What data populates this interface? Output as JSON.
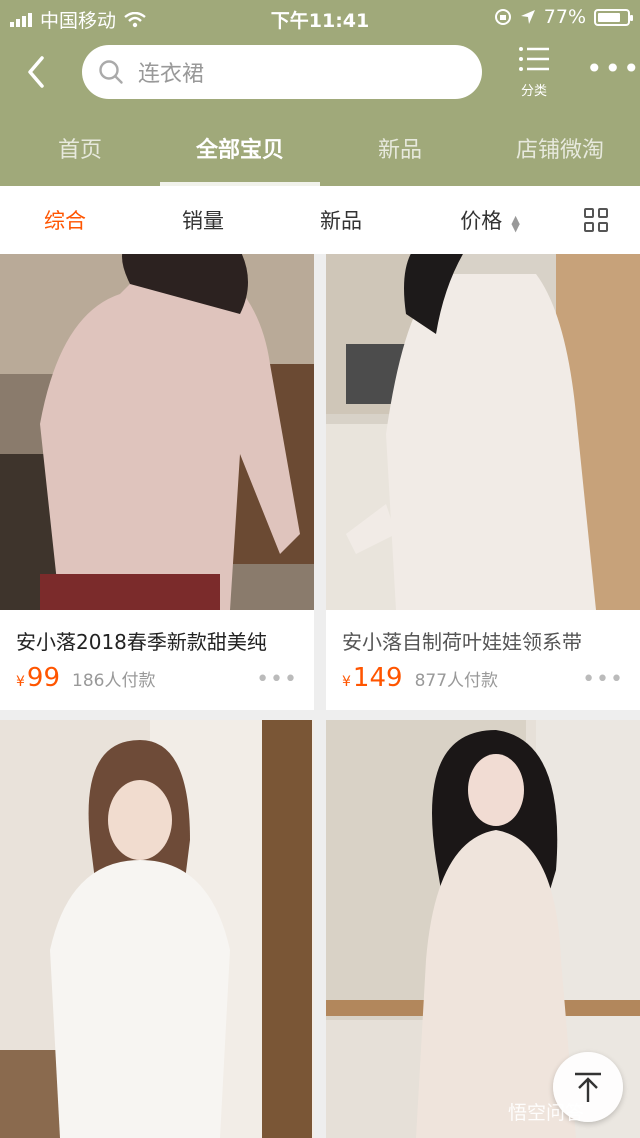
{
  "status_bar": {
    "carrier": "中国移动",
    "time": "下午11:41",
    "battery": "77%",
    "battery_level": 0.77
  },
  "header": {
    "search_placeholder": "连衣裙",
    "category_label": "分类",
    "icons": [
      "back-arrow-icon",
      "search-icon",
      "category-list-icon",
      "more-icon"
    ]
  },
  "tabs": [
    {
      "label": "首页",
      "active": false
    },
    {
      "label": "全部宝贝",
      "active": true
    },
    {
      "label": "新品",
      "active": false
    },
    {
      "label": "店铺微淘",
      "active": false
    }
  ],
  "sort": {
    "items": [
      {
        "label": "综合",
        "active": true
      },
      {
        "label": "销量",
        "active": false
      },
      {
        "label": "新品",
        "active": false
      },
      {
        "label": "价格",
        "active": false
      }
    ]
  },
  "products": [
    {
      "title": "安小落2018春季新款甜美纯",
      "currency": "¥",
      "price": "99",
      "sold": "186人付款"
    },
    {
      "title": "安小落自制荷叶娃娃领系带",
      "currency": "¥",
      "price": "149",
      "sold": "877人付款"
    },
    {
      "title": "",
      "currency": "",
      "price": "",
      "sold": ""
    },
    {
      "title": "",
      "currency": "",
      "price": "",
      "sold": ""
    }
  ],
  "watermark": "悟空问答",
  "colors": {
    "header_bg": "#a0a97a",
    "accent": "#ff5500"
  }
}
